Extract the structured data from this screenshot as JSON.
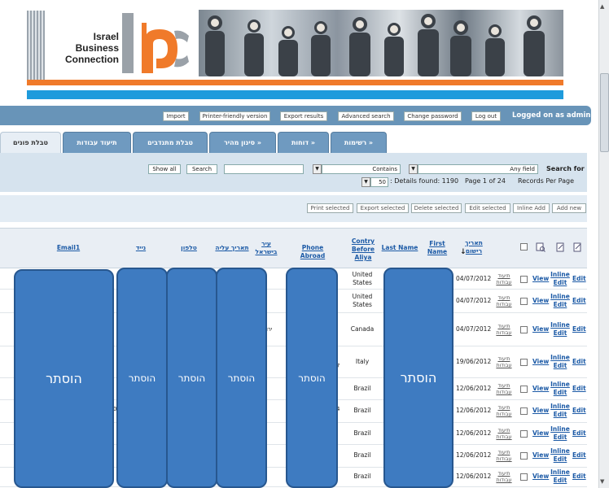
{
  "header": {
    "logo_line1": "Israel",
    "logo_line2": "Business",
    "logo_line3": "Connection"
  },
  "toolbar": {
    "buttons": [
      "Import",
      "Printer-friendly version",
      "Export results",
      "Advanced search",
      "Change password",
      "Log out"
    ],
    "logged_in": "Logged on as admin"
  },
  "tabs": [
    {
      "label": "טבלת פונים",
      "active": true
    },
    {
      "label": "תיעוד עבודות",
      "active": false
    },
    {
      "label": "טבלת מתנדבים",
      "active": false
    },
    {
      "label": "סינון מהיר »",
      "active": false
    },
    {
      "label": "דוחות »",
      "active": false
    },
    {
      "label": "רשימות »",
      "active": false
    }
  ],
  "search": {
    "label": "Search for",
    "field_select": "Any field",
    "operator_select": "Contains",
    "search_button": "Search",
    "show_all_button": "Show all",
    "per_page_select": "50",
    "details": ": Details found: 1190",
    "page": "Page 1 of 24",
    "records_per_page": "Records Per Page"
  },
  "actions": [
    "Print selected",
    "Export selected",
    "Delete selected",
    "Edit selected",
    "Inline Add",
    "Add new"
  ],
  "columns": {
    "email": "Email1",
    "mobile": "נייד",
    "phone": "טלפון",
    "aliya_date": "תאריך עליה",
    "city": "עיר בישראל",
    "phone_abroad": "Phone Abroad",
    "country": "Contry Before Aliya",
    "last_name": "Last Name",
    "first_name": "First Name",
    "reg_date": "תאריך רישום"
  },
  "row_links": {
    "work_log": "תיעוד עבודות",
    "view": "View",
    "inline_edit": "Inline Edit",
    "edit": "Edit"
  },
  "rows": [
    {
      "country": "United States",
      "date": "04/07/2012"
    },
    {
      "country": "United States",
      "date": "04/07/2012"
    },
    {
      "country": "Canada",
      "date": "04/07/2012"
    },
    {
      "country": "Italy",
      "date": "19/06/2012"
    },
    {
      "country": "Brazil",
      "date": "12/06/2012"
    },
    {
      "country": "Brazil",
      "date": "12/06/2012"
    },
    {
      "country": "Brazil",
      "date": "12/06/2012"
    },
    {
      "country": "Brazil",
      "date": "12/06/2012"
    },
    {
      "country": "Brazil",
      "date": "12/06/2012"
    }
  ],
  "partial_text": {
    "city_fragment": "ירוש",
    "phone_fragment_1": "7",
    "phone_fragment_2": "4",
    "mobile_fragment": "0"
  },
  "overlay_label": "הוסתר",
  "colors": {
    "orange": "#f07a2a",
    "blue": "#1e9bdc",
    "toolbar": "#6894b8",
    "overlay": "#3e7bc1",
    "link": "#1c5aa6"
  }
}
